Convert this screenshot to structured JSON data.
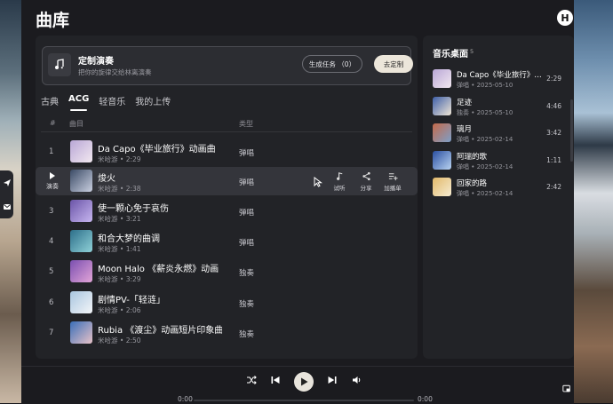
{
  "app": {
    "title": "曲库",
    "avatar_letter": "H"
  },
  "banner": {
    "title": "定制演奏",
    "subtitle": "把你的旋律交给林离演奏",
    "task_button": "生成任务 （0）",
    "custom_button": "去定制",
    "icon": "music-note-sparkle-icon"
  },
  "tabs": [
    {
      "label": "古典",
      "active": false
    },
    {
      "label": "ACG",
      "active": true
    },
    {
      "label": "轻音乐",
      "active": false
    },
    {
      "label": "我的上传",
      "active": false
    }
  ],
  "table": {
    "headers": {
      "num": "#",
      "title": "曲目",
      "type": "类型"
    },
    "rows": [
      {
        "num": "1",
        "title": "Da Capo《毕业旅行》动画曲",
        "artist": "米哈游",
        "duration": "2:29",
        "type": "弹唱",
        "cover_colors": [
          "#b9a7d6",
          "#f2e8f0"
        ]
      },
      {
        "num": "2",
        "title": "焌火",
        "artist": "米哈游",
        "duration": "2:38",
        "type": "弹唱",
        "cover_colors": [
          "#3b4b66",
          "#c9cfe0"
        ]
      },
      {
        "num": "3",
        "title": "使一颗心免于哀伤",
        "artist": "米哈游",
        "duration": "3:21",
        "type": "弹唱",
        "cover_colors": [
          "#6b55a8",
          "#c7b6f0"
        ]
      },
      {
        "num": "4",
        "title": "和合大梦的曲调",
        "artist": "米哈游",
        "duration": "1:41",
        "type": "弹唱",
        "cover_colors": [
          "#2d6f8a",
          "#8fd1d8"
        ]
      },
      {
        "num": "5",
        "title": "Moon Halo 《薪炎永燃》动画",
        "artist": "米哈游",
        "duration": "3:29",
        "type": "独奏",
        "cover_colors": [
          "#7a4fb0",
          "#e3a5d8"
        ]
      },
      {
        "num": "6",
        "title": "剧情PV-「轻涟」",
        "artist": "米哈游",
        "duration": "2:06",
        "type": "独奏",
        "cover_colors": [
          "#a9c6e0",
          "#f3f5f8"
        ]
      },
      {
        "num": "7",
        "title": "Rubia 《渡尘》动画短片印象曲",
        "artist": "米哈游",
        "duration": "2:50",
        "type": "独奏",
        "cover_colors": [
          "#3a6fb8",
          "#e8c2c8"
        ]
      }
    ],
    "hover_row": {
      "play_label": "演奏",
      "actions": [
        "试听",
        "分享",
        "加播单"
      ]
    }
  },
  "desk": {
    "title": "音乐桌面",
    "count": "5",
    "items": [
      {
        "title": "Da Capo《毕业旅行》动画曲",
        "type": "弹唱",
        "date": "2025-05-10",
        "duration": "2:29",
        "cover_colors": [
          "#b9a7d6",
          "#f2e8f0"
        ]
      },
      {
        "title": "足迹",
        "type": "独奏",
        "date": "2025-05-10",
        "duration": "4:46",
        "cover_colors": [
          "#3e5fa8",
          "#f0e6d6"
        ]
      },
      {
        "title": "璃月",
        "type": "弹唱",
        "date": "2025-02-14",
        "duration": "3:42",
        "cover_colors": [
          "#c56a4a",
          "#7d9fc8"
        ]
      },
      {
        "title": "阿瑞的歌",
        "type": "弹唱",
        "date": "2025-02-14",
        "duration": "1:11",
        "cover_colors": [
          "#2a4fa0",
          "#b9d3f2"
        ]
      },
      {
        "title": "回家的路",
        "type": "弹唱",
        "date": "2025-02-14",
        "duration": "2:42",
        "cover_colors": [
          "#e2b96a",
          "#f6ecd2"
        ]
      }
    ]
  },
  "player": {
    "time_elapsed": "0:00",
    "time_total": "0:00",
    "progress": 0
  }
}
